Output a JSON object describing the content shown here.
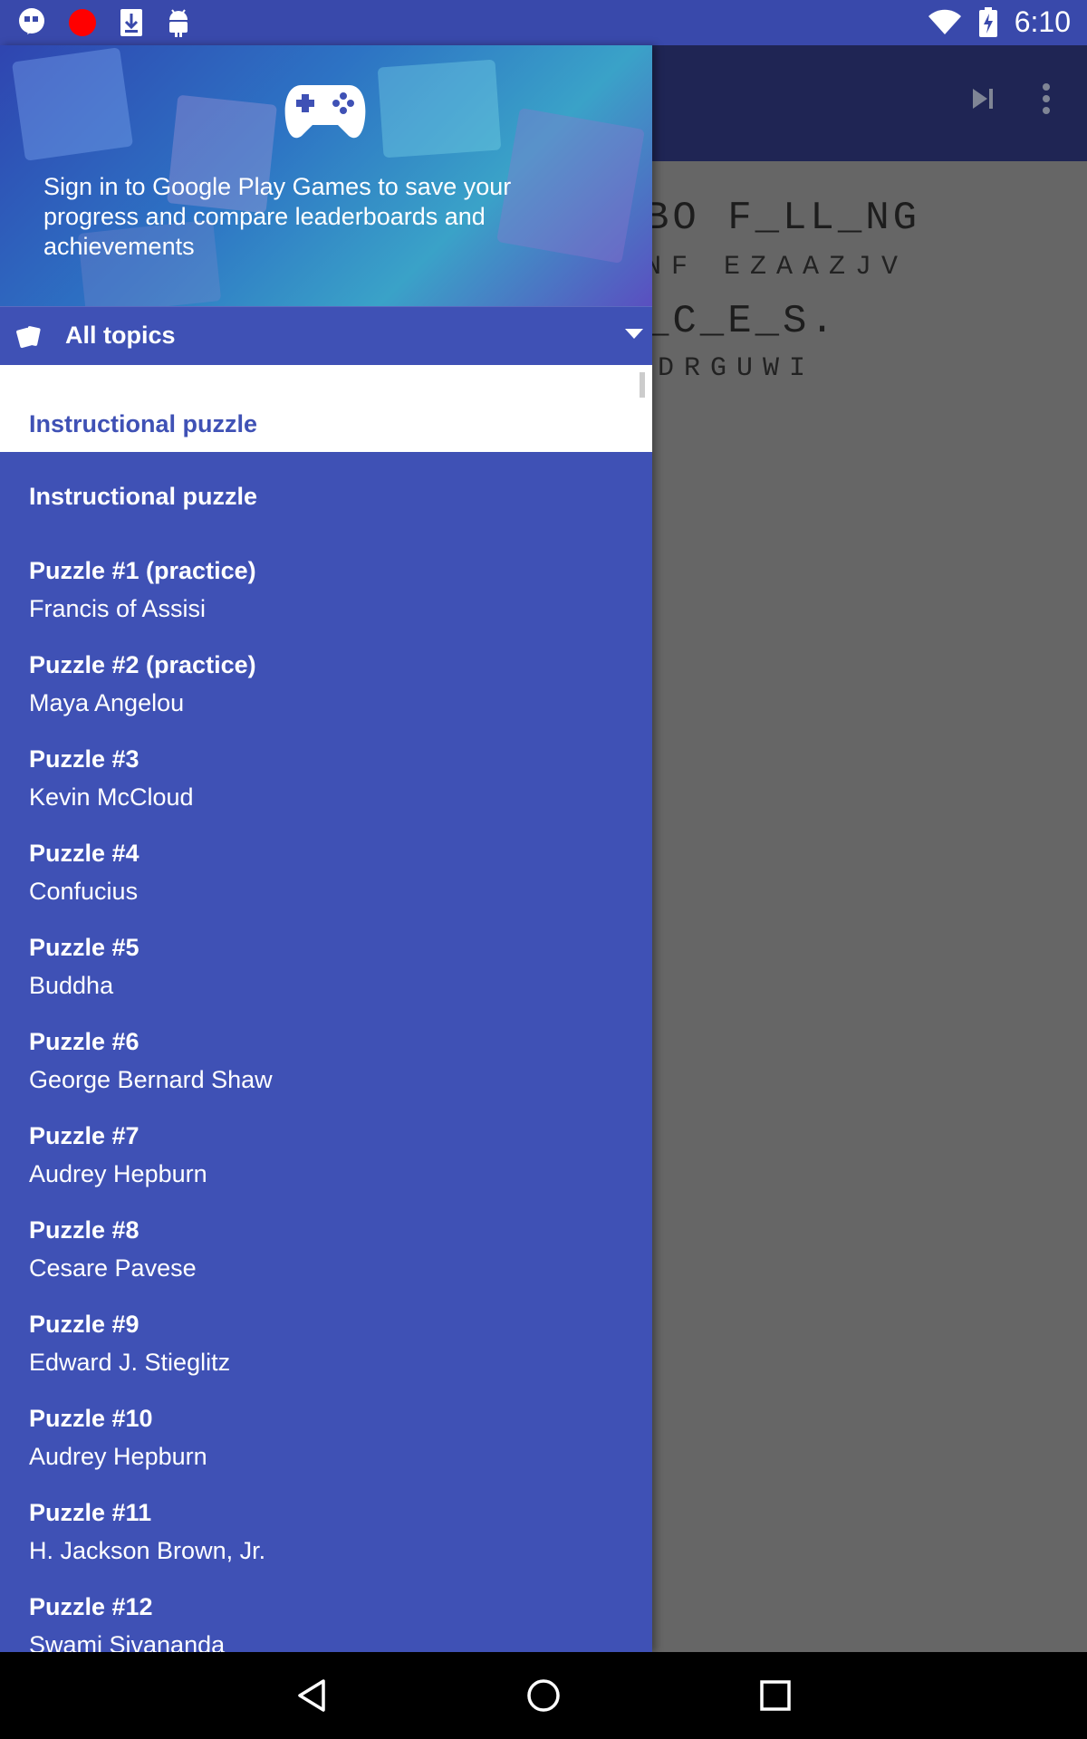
{
  "status_bar": {
    "time": "6:10",
    "left_icons": [
      "hangouts-icon",
      "record-icon",
      "download-icon",
      "android-icon"
    ],
    "right_icons": [
      "wifi-icon",
      "battery-charging-icon"
    ]
  },
  "app_bar": {
    "actions": [
      "skip-next-icon",
      "more-vert-icon"
    ]
  },
  "puzzle": {
    "line1": "BO F_LL_NG",
    "line2": "NF EZAAZJV",
    "line3": "_C_E_S.",
    "line4": "DRGUWI"
  },
  "drawer": {
    "header_text": "Sign in to Google Play Games to save your progress and compare leaderboards and achievements",
    "topic_selector": "All topics",
    "selected_item": "Instructional puzzle",
    "first_item": "Instructional puzzle",
    "items": [
      {
        "title": "Puzzle #1 (practice)",
        "subtitle": "Francis of Assisi"
      },
      {
        "title": "Puzzle #2 (practice)",
        "subtitle": "Maya Angelou"
      },
      {
        "title": "Puzzle #3",
        "subtitle": "Kevin McCloud"
      },
      {
        "title": "Puzzle #4",
        "subtitle": "Confucius"
      },
      {
        "title": "Puzzle #5",
        "subtitle": "Buddha"
      },
      {
        "title": "Puzzle #6",
        "subtitle": "George Bernard Shaw"
      },
      {
        "title": "Puzzle #7",
        "subtitle": "Audrey Hepburn"
      },
      {
        "title": "Puzzle #8",
        "subtitle": "Cesare Pavese"
      },
      {
        "title": "Puzzle #9",
        "subtitle": "Edward J. Stieglitz"
      },
      {
        "title": "Puzzle #10",
        "subtitle": "Audrey Hepburn"
      },
      {
        "title": "Puzzle #11",
        "subtitle": "H. Jackson Brown, Jr."
      },
      {
        "title": "Puzzle #12",
        "subtitle": "Swami Sivananda"
      }
    ]
  },
  "nav_bar": {
    "buttons": [
      "back-icon",
      "home-icon",
      "recents-icon"
    ]
  },
  "colors": {
    "primary": "#3F51B5",
    "status_bar": "#3949AB",
    "scrim_content": "#666666"
  }
}
